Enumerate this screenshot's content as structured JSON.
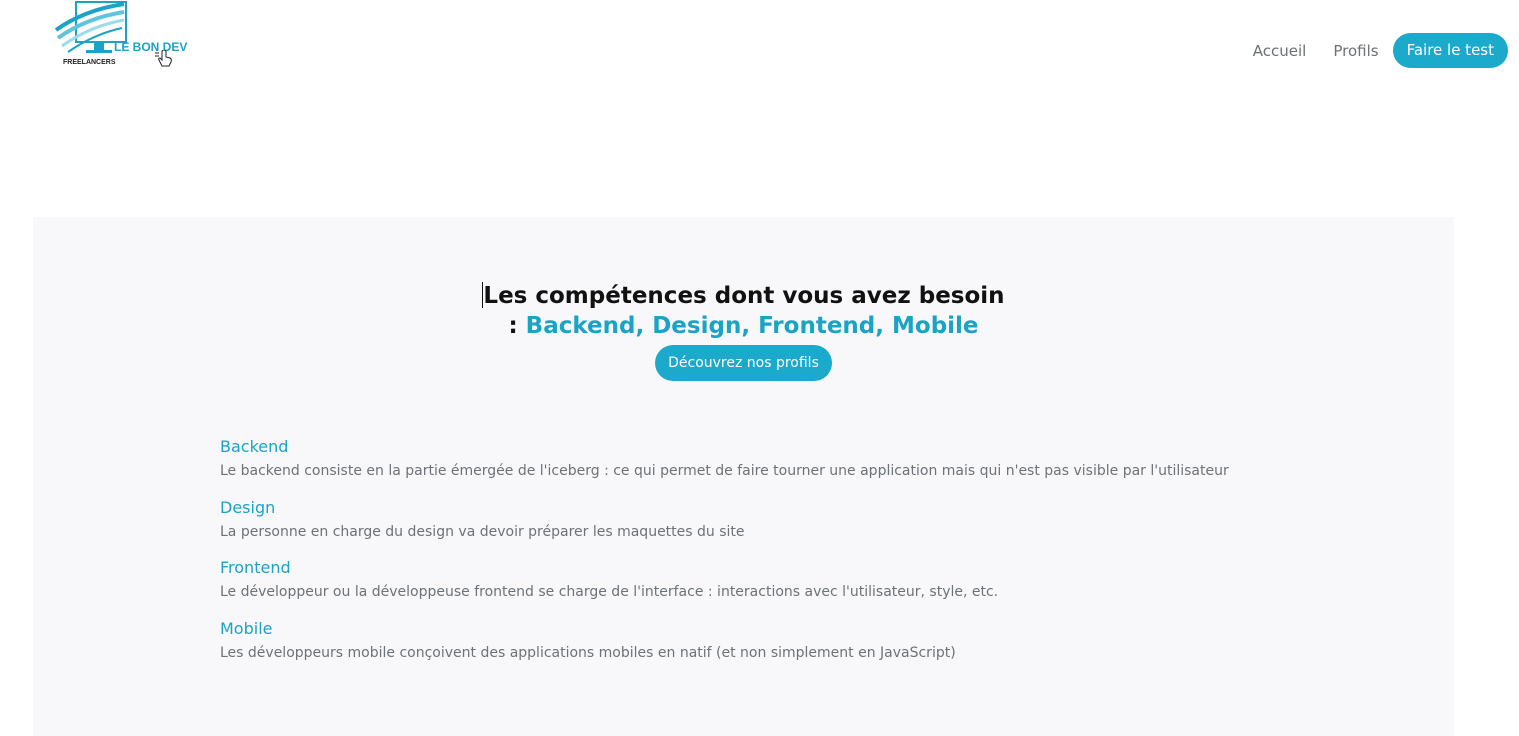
{
  "header": {
    "logo": {
      "brand_text": "LE BON DEV",
      "sub_text": "FREELANCERS"
    },
    "nav": {
      "home_label": "Accueil",
      "profiles_label": "Profils",
      "cta_label": "Faire le test"
    }
  },
  "hero": {
    "title_line1": "Les compétences dont vous avez besoin",
    "title_prefix": ": ",
    "title_skills": "Backend, Design, Frontend, Mobile",
    "cta_label": "Découvrez nos profils"
  },
  "skills": [
    {
      "name": "Backend",
      "description": "Le backend consiste en la partie émergée de l'iceberg : ce qui permet de faire tourner une application mais qui n'est pas visible par l'utilisateur"
    },
    {
      "name": "Design",
      "description": "La personne en charge du design va devoir préparer les maquettes du site"
    },
    {
      "name": "Frontend",
      "description": "Le développeur ou la développeuse frontend se charge de l'interface : interactions avec l'utilisateur, style, etc."
    },
    {
      "name": "Mobile",
      "description": "Les développeurs mobile conçoivent des applications mobiles en natif (et non simplement en JavaScript)"
    }
  ],
  "colors": {
    "accent": "#1ba9cc",
    "accent_text": "#1aa3c4",
    "section_bg": "#f8f8fa",
    "muted_text": "#6d7278"
  },
  "icons": [
    "monitor-logo-icon",
    "hand-pointer-icon"
  ]
}
